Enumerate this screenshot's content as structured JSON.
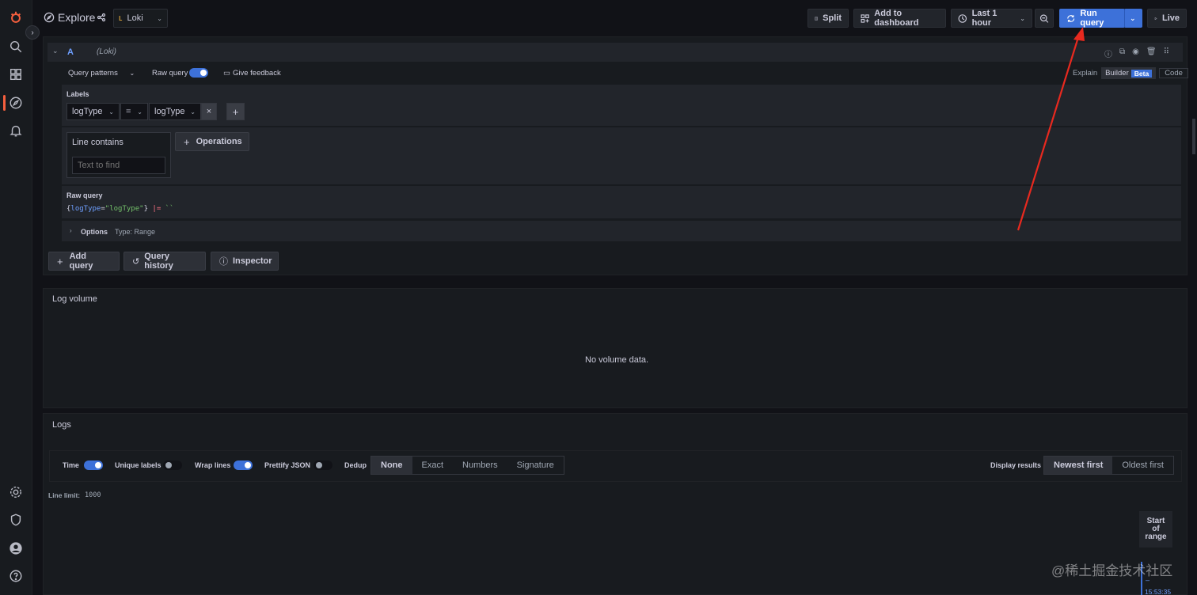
{
  "app": {
    "title": "Explore",
    "datasource": "Loki"
  },
  "toolbar": {
    "split": "Split",
    "add_to_dashboard": "Add to dashboard",
    "time_range": "Last 1 hour",
    "run_query": "Run query",
    "live": "Live"
  },
  "query": {
    "ref_id": "A",
    "ds_label": "(Loki)",
    "query_patterns": "Query patterns",
    "raw_query_toggle": "Raw query",
    "give_feedback": "Give feedback",
    "modes": {
      "explain": "Explain",
      "builder": "Builder",
      "beta": "Beta",
      "code": "Code"
    },
    "labels_title": "Labels",
    "label_name": "logType",
    "label_op": "=",
    "label_value": "logType",
    "line_contains": "Line contains",
    "text_placeholder": "Text to find",
    "operations": "Operations",
    "raw_query_title": "Raw query",
    "raw_brace_open": "{",
    "raw_key": "logType",
    "raw_eq": "=",
    "raw_val": "\"logType\"",
    "raw_brace_close": "}",
    "raw_op": "|=",
    "raw_str": "``",
    "options": "Options",
    "options_type": "Type: Range"
  },
  "actions": {
    "add_query": "Add query",
    "query_history": "Query history",
    "inspector": "Inspector"
  },
  "log_volume": {
    "title": "Log volume",
    "empty": "No volume data."
  },
  "logs": {
    "title": "Logs",
    "time": "Time",
    "unique_labels": "Unique labels",
    "wrap_lines": "Wrap lines",
    "prettify_json": "Prettify JSON",
    "dedup": "Dedup",
    "dedup_options": [
      "None",
      "Exact",
      "Numbers",
      "Signature"
    ],
    "display_results": "Display results",
    "order_options": [
      "Newest first",
      "Oldest first"
    ],
    "line_limit_label": "Line limit:",
    "line_limit_value": "1000",
    "start_of_range": [
      "Start",
      "of",
      "range"
    ],
    "timestamp": "15:53:35"
  },
  "watermark": "@稀土掘金技术社区",
  "colors": {
    "accent": "#3d71d9",
    "brand": "#f55f3e",
    "annotation_arrow": "#e8291f"
  }
}
